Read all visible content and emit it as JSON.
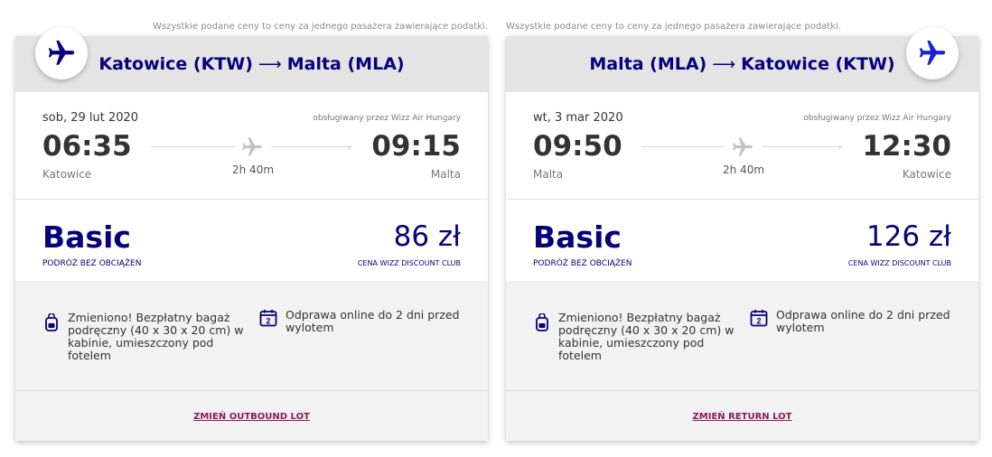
{
  "disclaimer": "Wszystkie podane ceny to ceny za jednego pasażera zawierające podatki.",
  "outbound": {
    "route_from": "Katowice (KTW)",
    "route_arrow": "⟶",
    "route_to": "Malta (MLA)",
    "date": "sob, 29 lut 2020",
    "operator": "obsługiwany przez Wizz Air Hungary",
    "dep_time": "06:35",
    "arr_time": "09:15",
    "dep_city": "Katowice",
    "arr_city": "Malta",
    "duration": "2h 40m",
    "fare_name": "Basic",
    "fare_sub": "PODRÓŻ BEZ OBCIĄŻEŃ",
    "price": "86 zł",
    "price_sub": "CENA WIZZ DISCOUNT CLUB",
    "feature_bag": "Zmieniono! Bezpłatny bagaż podręczny (40 x 30 x 20 cm) w kabinie, umieszczony pod fotelem",
    "feature_checkin": "Odprawa online do 2 dni przed wylotem",
    "calendar_num": "2",
    "change_label": "ZMIEŃ OUTBOUND LOT"
  },
  "return": {
    "route_from": "Malta (MLA)",
    "route_arrow": "⟶",
    "route_to": "Katowice (KTW)",
    "date": "wt, 3 mar 2020",
    "operator": "obsługiwany przez Wizz Air Hungary",
    "dep_time": "09:50",
    "arr_time": "12:30",
    "dep_city": "Malta",
    "arr_city": "Katowice",
    "duration": "2h 40m",
    "fare_name": "Basic",
    "fare_sub": "PODRÓŻ BEZ OBCIĄŻEŃ",
    "price": "126 zł",
    "price_sub": "CENA WIZZ DISCOUNT CLUB",
    "feature_bag": "Zmieniono! Bezpłatny bagaż podręczny (40 x 30 x 20 cm) w kabinie, umieszczony pod fotelem",
    "feature_checkin": "Odprawa online do 2 dni przed wylotem",
    "calendar_num": "2",
    "change_label": "ZMIEŃ RETURN LOT"
  },
  "icons": {
    "badge_outbound": "airplane-icon",
    "badge_return": "airplane-icon",
    "duration": "airplane-icon",
    "bag": "backpack-icon",
    "checkin": "calendar-icon"
  },
  "colors": {
    "brand_navy": "#06007a",
    "brand_accent": "#8a1a5e"
  }
}
